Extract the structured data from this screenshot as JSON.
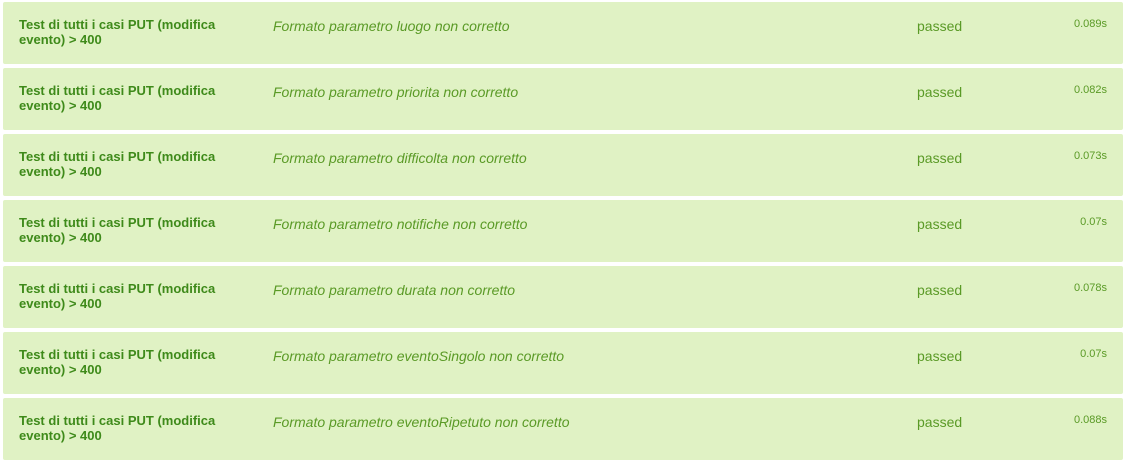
{
  "colors": {
    "row_background": "#e0f2c4",
    "suite_text": "#3e8a1a",
    "text": "#5a9a26"
  },
  "rows": [
    {
      "suite": "Test di tutti i casi PUT (modifica evento) > 400",
      "test": "Formato parametro luogo non corretto",
      "status": "passed",
      "duration": "0.089s"
    },
    {
      "suite": "Test di tutti i casi PUT (modifica evento) > 400",
      "test": "Formato parametro priorita non corretto",
      "status": "passed",
      "duration": "0.082s"
    },
    {
      "suite": "Test di tutti i casi PUT (modifica evento) > 400",
      "test": "Formato parametro difficolta non corretto",
      "status": "passed",
      "duration": "0.073s"
    },
    {
      "suite": "Test di tutti i casi PUT (modifica evento) > 400",
      "test": "Formato parametro notifiche non corretto",
      "status": "passed",
      "duration": "0.07s"
    },
    {
      "suite": "Test di tutti i casi PUT (modifica evento) > 400",
      "test": "Formato parametro durata non corretto",
      "status": "passed",
      "duration": "0.078s"
    },
    {
      "suite": "Test di tutti i casi PUT (modifica evento) > 400",
      "test": "Formato parametro eventoSingolo non corretto",
      "status": "passed",
      "duration": "0.07s"
    },
    {
      "suite": "Test di tutti i casi PUT (modifica evento) > 400",
      "test": "Formato parametro eventoRipetuto non corretto",
      "status": "passed",
      "duration": "0.088s"
    }
  ]
}
